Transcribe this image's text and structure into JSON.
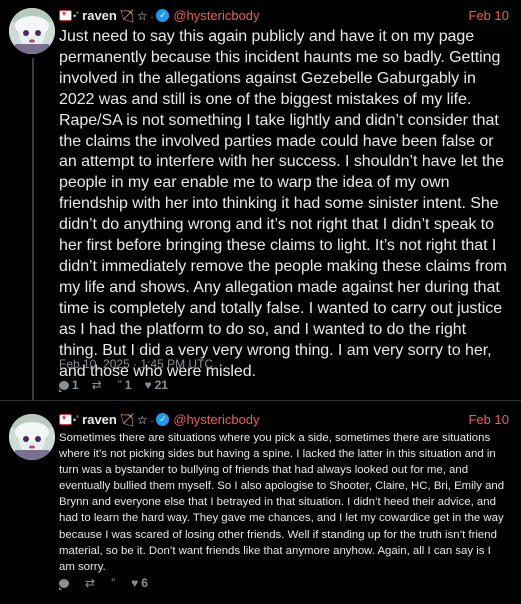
{
  "posts": [
    {
      "author": {
        "name": "raven",
        "handle": "@hystericbody"
      },
      "date": "Feb 10",
      "text": "Just need to say this again publicly and have it on my page permanently because this incident haunts me so badly. Getting involved in the allegations against Gezebelle Gaburgably in 2022 was and still is one of the biggest mistakes of my life. Rape/SA is not something I take lightly and didn’t consider that the claims the involved parties made could have been false or an attempt to interfere with her success. I shouldn’t have let the people in my ear enable me to warp the idea of my own friendship with her into thinking it had some sinister intent. She didn’t do anything wrong and it’s not right that I didn’t speak to her first before bringing these claims to light. It’s not right that I didn’t immediately remove the people making these claims from my life and shows. Any allegation made against her during that time is completely and totally false. I wanted to carry out justice as I had the platform to do so, and I wanted to do the right thing. But I did a very very wrong thing. I am very sorry to her, and those who were misled.",
      "timestamp": "Feb 10, 2025 · 1:45 PM UTC",
      "stats": {
        "replies": "1",
        "reposts": "",
        "quotes": "1",
        "likes": "21"
      }
    },
    {
      "author": {
        "name": "raven",
        "handle": "@hystericbody"
      },
      "date": "Feb 10",
      "text": "Sometimes there are situations where you pick a side, sometimes there are situations where it’s not picking sides but having a spine. I lacked the latter in this situation and in turn was a bystander to bullying of friends that had always looked out for me, and eventually bullied them myself. So I also apologise to Shooter, Claire, HC, Bri, Emily and Brynn and everyone else that I betrayed in that situation. I didn’t heed their advice, and had to learn the hard way. They gave me chances, and I let my cowardice get in the way because I was scared of losing other friends. Well if standing up for the truth isn’t friend material, so be it. Don’t want friends like that anymore anyhow. Again, all I can say is I am sorry.",
      "stats": {
        "replies": "",
        "reposts": "",
        "quotes": "",
        "likes": "6"
      }
    }
  ],
  "icons": {
    "reply": "speech-bubble",
    "repost": "repost-arrows",
    "quote": "quote-marks",
    "like": "heart"
  },
  "colors": {
    "accent": "#f25a5a",
    "verified": "#1d9bf0",
    "background": "#000000",
    "muted": "#8b8f94"
  }
}
